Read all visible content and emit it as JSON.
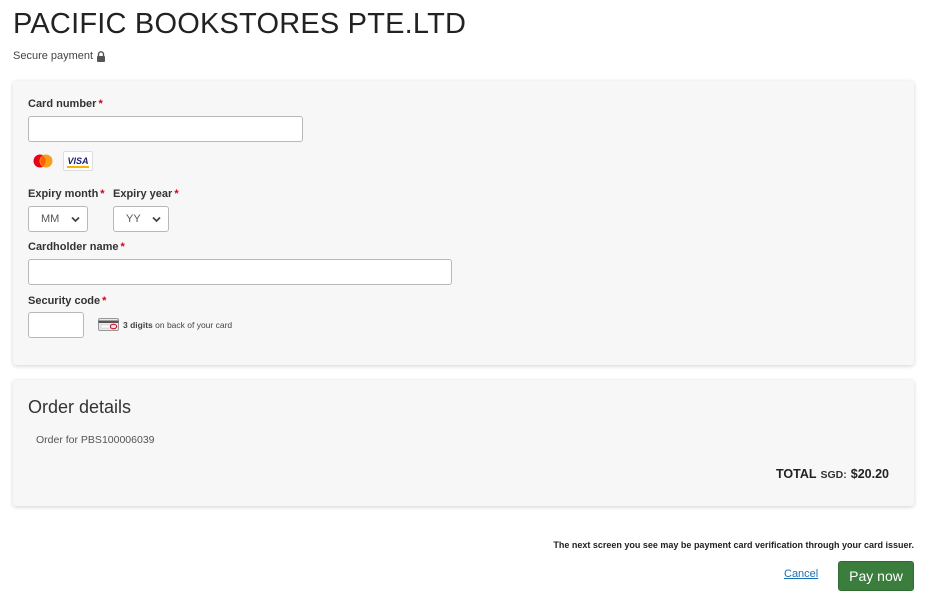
{
  "merchant": {
    "name": "PACIFIC BOOKSTORES PTE.LTD"
  },
  "secure": {
    "label": "Secure payment",
    "icon": "lock-icon"
  },
  "card_form": {
    "card_number": {
      "label": "Card number",
      "required": "*",
      "value": ""
    },
    "brands": [
      "mastercard",
      "visa"
    ],
    "visa_text": "VISA",
    "expiry_month": {
      "label": "Expiry month",
      "required": "*",
      "selected": "MM"
    },
    "expiry_year": {
      "label": "Expiry year",
      "required": "*",
      "selected": "YY"
    },
    "cardholder_name": {
      "label": "Cardholder name",
      "required": "*",
      "value": ""
    },
    "security_code": {
      "label": "Security code",
      "required": "*",
      "value": "",
      "hint_bold": "3 digits",
      "hint_rest": " on back of your card"
    }
  },
  "order": {
    "title": "Order details",
    "reference": "Order for PBS100006039",
    "total_label": "TOTAL",
    "currency": "SGD:",
    "total_amount": "$20.20"
  },
  "footer": {
    "notice": "The next screen you see may be payment card verification through your card issuer.",
    "cancel_label": "Cancel",
    "pay_label": "Pay now"
  },
  "colors": {
    "pay_button": "#3b7d3d",
    "link": "#1a6fb6",
    "required": "#d0021b",
    "panel": "#f7f7f7"
  }
}
